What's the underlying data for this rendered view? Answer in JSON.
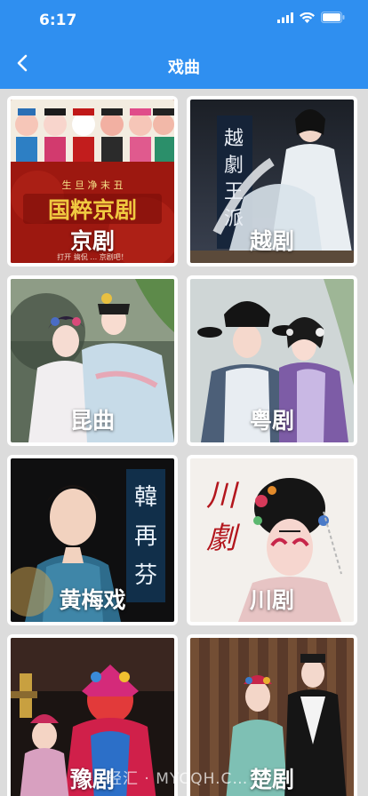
{
  "status_bar": {
    "time": "6:17"
  },
  "nav": {
    "title": "戏曲"
  },
  "items": [
    {
      "label": "京剧",
      "caption": "国粹京剧",
      "sub": "生 旦 净 末 丑",
      "bottom": "打开 搞侃 … 京剧吧！"
    },
    {
      "label": "越剧",
      "caption": "越劇王派"
    },
    {
      "label": "昆曲"
    },
    {
      "label": "粤剧"
    },
    {
      "label": "黄梅戏",
      "caption": "韓再芬"
    },
    {
      "label": "川剧",
      "caption": "川劇"
    },
    {
      "label": "豫剧"
    },
    {
      "label": "楚剧"
    }
  ],
  "watermark": "轻汇 · MYCQH.C…",
  "colors": {
    "header": "#2f8ff0",
    "background": "#dcdcdc"
  }
}
